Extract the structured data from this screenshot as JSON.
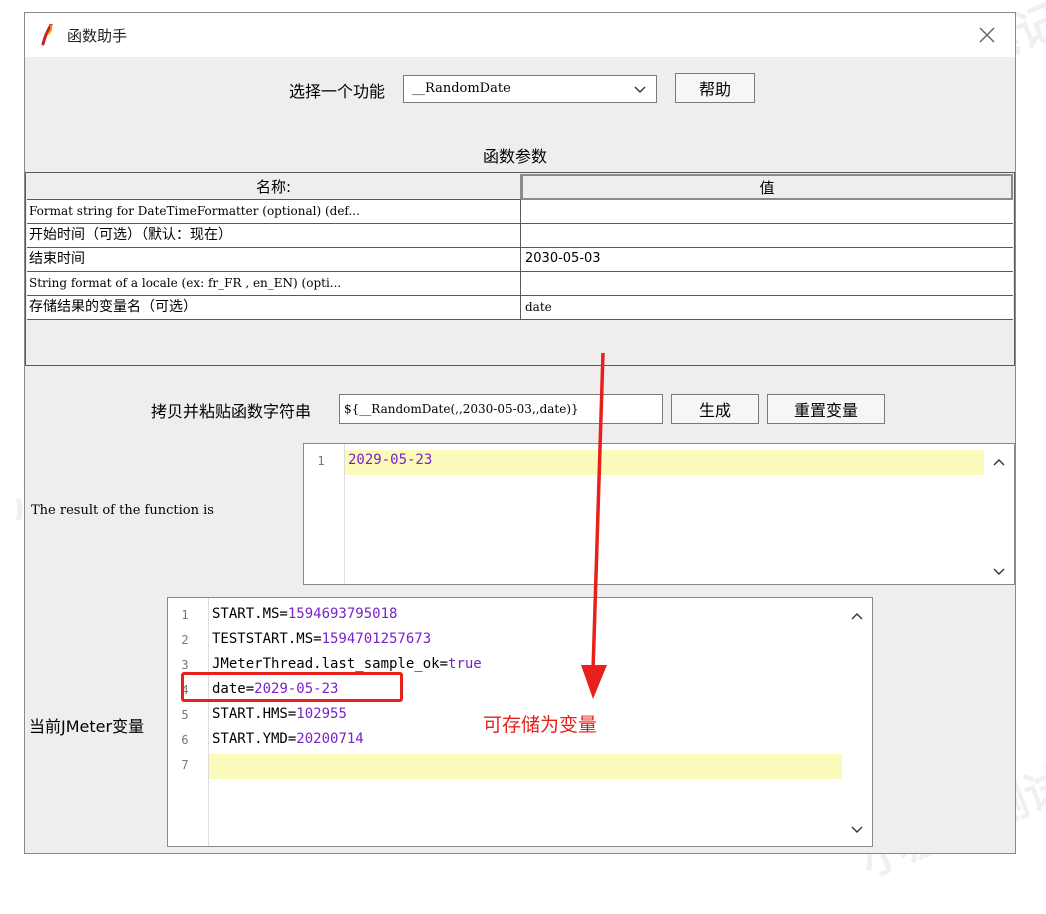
{
  "window": {
    "title": "函数助手"
  },
  "function_select": {
    "label": "选择一个功能",
    "selected": "__RandomDate",
    "help_label": "帮助"
  },
  "params": {
    "title": "函数参数",
    "headers": [
      "名称:",
      "值"
    ],
    "rows": [
      {
        "name": "Format string for DateTimeFormatter (optional) (def...",
        "value": ""
      },
      {
        "name": "开始时间（可选）（默认：现在）",
        "value": ""
      },
      {
        "name": "结束时间",
        "value": "2030-05-03"
      },
      {
        "name": "String format of a locale (ex: fr_FR , en_EN) (opti...",
        "value": ""
      },
      {
        "name": "存储结果的变量名（可选）",
        "value": "date"
      }
    ]
  },
  "copy": {
    "label": "拷贝并粘贴函数字符串",
    "value": "${__RandomDate(,,2030-05-03,,date)}",
    "generate_label": "生成",
    "reset_label": "重置变量"
  },
  "result": {
    "label": "The result of the function is",
    "lines": [
      {
        "num": "1",
        "value": "2029-05-23"
      }
    ]
  },
  "vars": {
    "label": "当前JMeter变量",
    "lines": [
      {
        "num": "1",
        "key": "START.MS=",
        "value": "1594693795018"
      },
      {
        "num": "2",
        "key": "TESTSTART.MS=",
        "value": "1594701257673"
      },
      {
        "num": "3",
        "key": "JMeterThread.last_sample_ok=",
        "value": "true"
      },
      {
        "num": "4",
        "key": "date=",
        "value": "2029-05-23"
      },
      {
        "num": "5",
        "key": "START.HMS=",
        "value": "102955"
      },
      {
        "num": "6",
        "key": "START.YMD=",
        "value": "20200714"
      },
      {
        "num": "7",
        "key": "",
        "value": ""
      }
    ]
  },
  "annotation": {
    "text": "可存储为变量",
    "color": "#e8201c"
  },
  "watermark": {
    "text": "小菠萝测试笔记"
  },
  "colors": {
    "value_purple": "#7a22c9",
    "highlight": "#fafaba",
    "window_bg": "#eeeeee"
  }
}
